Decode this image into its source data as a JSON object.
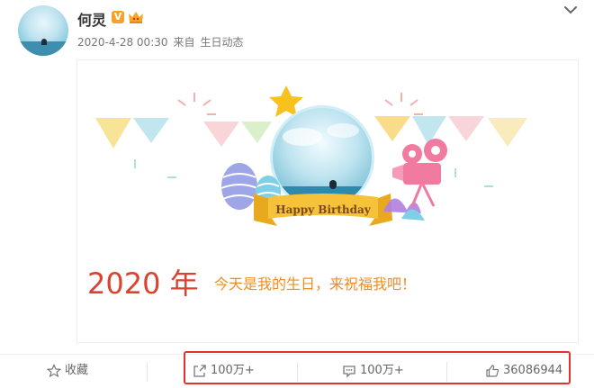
{
  "post": {
    "username": "何灵",
    "verified_badge": "V",
    "timestamp": "2020-4-28 00:30",
    "source_prefix": "来自",
    "source": "生日动态"
  },
  "card": {
    "banner_text": "Happy Birthday",
    "year": "2020 年",
    "message": "今天是我的生日，来祝福我吧！"
  },
  "actions": {
    "favorite_label": "收藏",
    "share_count": "100万+",
    "comment_count": "100万+",
    "like_count": "36086944"
  },
  "icons": [
    "collapse-chevron-icon",
    "verified-icon",
    "crown-icon",
    "star-icon",
    "share-icon",
    "comment-icon",
    "like-icon"
  ],
  "colors": {
    "accent_red": "#e0332b",
    "year_red": "#d9432f",
    "message_orange": "#f28c1e",
    "banner_yellow": "#f6c23a"
  }
}
